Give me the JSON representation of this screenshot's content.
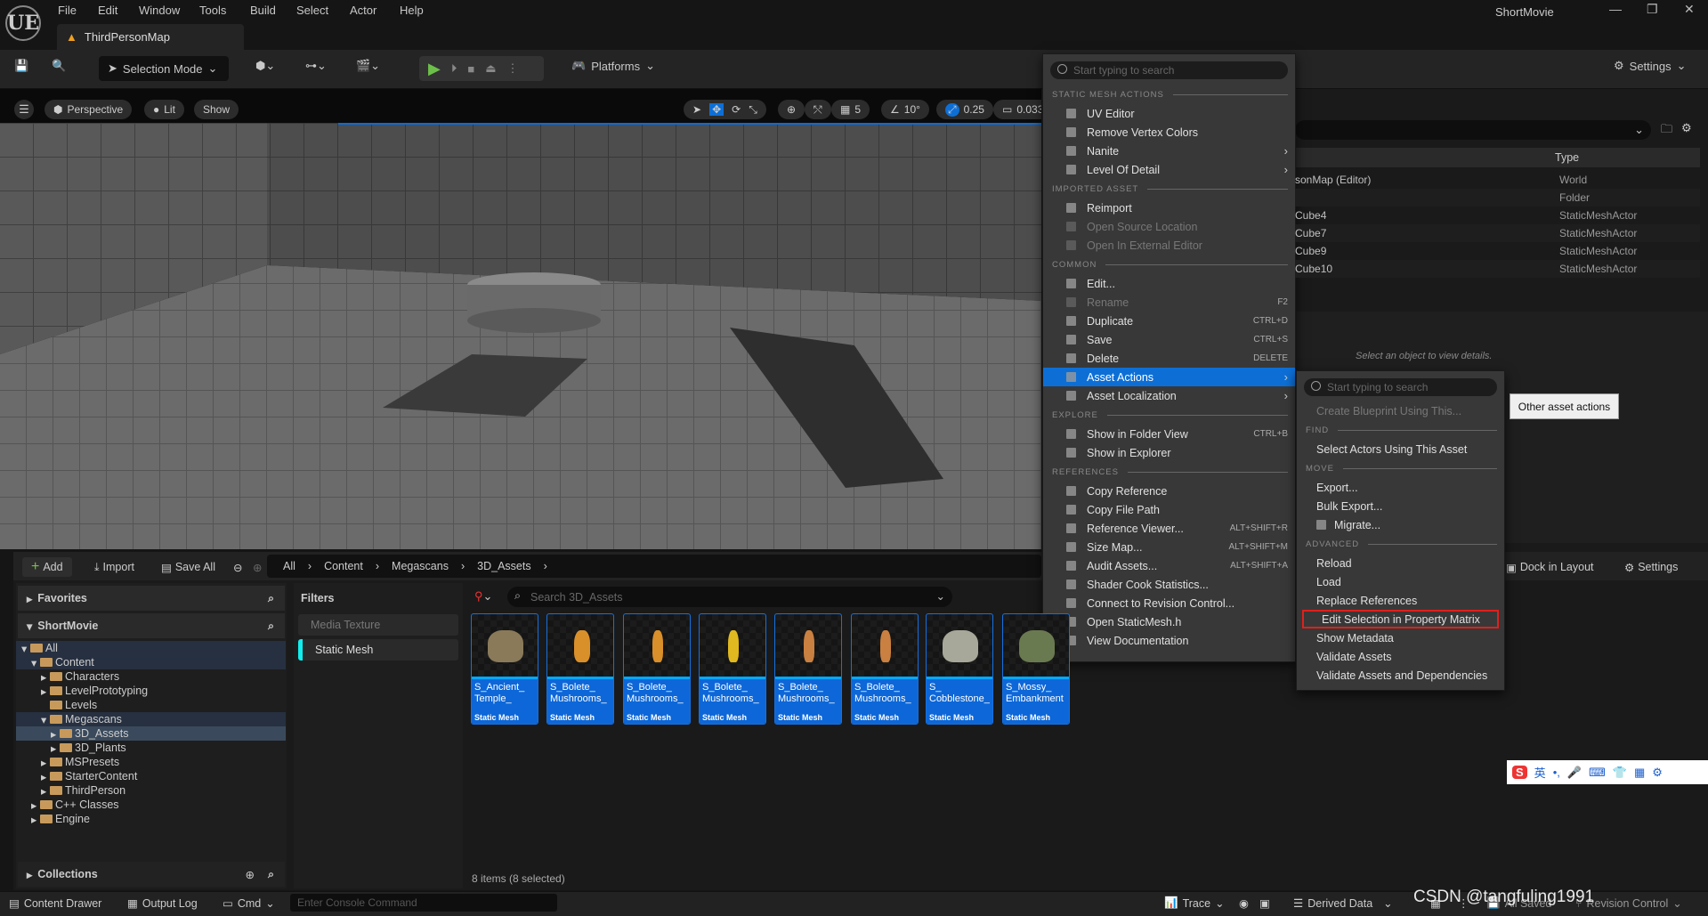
{
  "app": {
    "name": "ShortMovie",
    "logo": "UE",
    "level_tab": "ThirdPersonMap"
  },
  "menubar": [
    "File",
    "Edit",
    "Window",
    "Tools",
    "Build",
    "Select",
    "Actor",
    "Help"
  ],
  "toolbar": {
    "selection_mode": "Selection Mode",
    "platforms": "Platforms",
    "settings": "Settings"
  },
  "viewport": {
    "perspective": "Perspective",
    "lit": "Lit",
    "show": "Show",
    "grid_size": "5",
    "rotation_snap": "10°",
    "scale_snap": "0.25",
    "camera_speed": "0.033"
  },
  "outliner": {
    "type_header": "Type",
    "rows": [
      {
        "label": "sonMap (Editor)",
        "type": "World"
      },
      {
        "label": "",
        "type": "Folder"
      },
      {
        "label": "Cube4",
        "type": "StaticMeshActor"
      },
      {
        "label": "Cube7",
        "type": "StaticMeshActor"
      },
      {
        "label": "Cube9",
        "type": "StaticMeshActor"
      },
      {
        "label": "Cube10",
        "type": "StaticMeshActor"
      }
    ]
  },
  "details": {
    "empty_text": "Select an object to view details."
  },
  "content_browser": {
    "add": "Add",
    "import": "Import",
    "save_all": "Save All",
    "breadcrumbs": [
      "All",
      "Content",
      "Megascans",
      "3D_Assets"
    ],
    "dock_in_layout": "Dock in Layout",
    "settings": "Settings",
    "favorites": "Favorites",
    "project": "ShortMovie",
    "collections": "Collections",
    "tree": [
      {
        "label": "All",
        "depth": 0
      },
      {
        "label": "Content",
        "depth": 1
      },
      {
        "label": "Characters",
        "depth": 2
      },
      {
        "label": "LevelPrototyping",
        "depth": 2
      },
      {
        "label": "Levels",
        "depth": 2
      },
      {
        "label": "Megascans",
        "depth": 2
      },
      {
        "label": "3D_Assets",
        "depth": 3,
        "selected": true
      },
      {
        "label": "3D_Plants",
        "depth": 3
      },
      {
        "label": "MSPresets",
        "depth": 2
      },
      {
        "label": "StarterContent",
        "depth": 2
      },
      {
        "label": "ThirdPerson",
        "depth": 2
      },
      {
        "label": "C++ Classes",
        "depth": 1
      },
      {
        "label": "Engine",
        "depth": 1
      }
    ],
    "filters_title": "Filters",
    "filters": [
      "Media Texture",
      "Static Mesh"
    ],
    "search_placeholder": "Search 3D_Assets",
    "assets": [
      {
        "name": "S_Ancient_ Temple_",
        "type": "Static Mesh",
        "color": "#8a7a5a"
      },
      {
        "name": "S_Bolete_ Mushrooms_",
        "type": "Static Mesh",
        "color": "#d9902a"
      },
      {
        "name": "S_Bolete_ Mushrooms_",
        "type": "Static Mesh",
        "color": "#d98f2a"
      },
      {
        "name": "S_Bolete_ Mushrooms_",
        "type": "Static Mesh",
        "color": "#e0b820"
      },
      {
        "name": "S_Bolete_ Mushrooms_",
        "type": "Static Mesh",
        "color": "#c98040"
      },
      {
        "name": "S_Bolete_ Mushrooms_",
        "type": "Static Mesh",
        "color": "#c98040"
      },
      {
        "name": "S_ Cobblestone_",
        "type": "Static Mesh",
        "color": "#a8a89a"
      },
      {
        "name": "S_Mossy_ Embankment",
        "type": "Static Mesh",
        "color": "#6a7a50"
      }
    ],
    "item_count": "8 items (8 selected)"
  },
  "context_menu": {
    "search_placeholder": "Start typing to search",
    "sections": [
      {
        "header": "STATIC MESH ACTIONS",
        "items": [
          {
            "label": "UV Editor",
            "icon": "uv-grid-icon"
          },
          {
            "label": "Remove Vertex Colors",
            "icon": "droplet-icon"
          },
          {
            "label": "Nanite",
            "icon": "wrench-icon",
            "submenu": true
          },
          {
            "label": "Level Of Detail",
            "icon": "lod-icon",
            "submenu": true
          }
        ]
      },
      {
        "header": "IMPORTED ASSET",
        "items": [
          {
            "label": "Reimport",
            "icon": "reimport-icon"
          },
          {
            "label": "Open Source Location",
            "icon": "open-location-icon",
            "disabled": true
          },
          {
            "label": "Open In External Editor",
            "icon": "external-editor-icon",
            "disabled": true
          }
        ]
      },
      {
        "header": "COMMON",
        "items": [
          {
            "label": "Edit...",
            "icon": "pencil-icon"
          },
          {
            "label": "Rename",
            "icon": "rename-icon",
            "shortcut": "F2",
            "disabled": true
          },
          {
            "label": "Duplicate",
            "icon": "duplicate-icon",
            "shortcut": "CTRL+D"
          },
          {
            "label": "Save",
            "icon": "save-icon",
            "shortcut": "CTRL+S"
          },
          {
            "label": "Delete",
            "icon": "trash-icon",
            "shortcut": "DELETE"
          },
          {
            "label": "Asset Actions",
            "icon": "wrench-icon",
            "submenu": true,
            "highlighted": true
          },
          {
            "label": "Asset Localization",
            "icon": "flag-icon",
            "submenu": true
          }
        ]
      },
      {
        "header": "EXPLORE",
        "items": [
          {
            "label": "Show in Folder View",
            "icon": "folder-view-icon",
            "shortcut": "CTRL+B"
          },
          {
            "label": "Show in Explorer",
            "icon": "explorer-icon"
          }
        ]
      },
      {
        "header": "REFERENCES",
        "items": [
          {
            "label": "Copy Reference",
            "icon": "copy-icon"
          },
          {
            "label": "Copy File Path",
            "icon": "copy-icon"
          },
          {
            "label": "Reference Viewer...",
            "icon": "reference-viewer-icon",
            "shortcut": "ALT+SHIFT+R"
          },
          {
            "label": "Size Map...",
            "icon": "size-map-icon",
            "shortcut": "ALT+SHIFT+M"
          },
          {
            "label": "Audit Assets...",
            "icon": "audit-icon",
            "shortcut": "ALT+SHIFT+A"
          },
          {
            "label": "Shader Cook Statistics...",
            "icon": "statistics-icon"
          },
          {
            "label": "Connect to Revision Control...",
            "icon": "revision-control-icon"
          },
          {
            "label": "Open StaticMesh.h",
            "icon": "source-file-icon"
          },
          {
            "label": "View Documentation",
            "icon": "documentation-icon"
          }
        ]
      }
    ]
  },
  "submenu": {
    "search_placeholder": "Start typing to search",
    "sections": [
      {
        "header": "",
        "items": [
          {
            "label": "Create Blueprint Using This...",
            "disabled": true
          }
        ]
      },
      {
        "header": "FIND",
        "items": [
          {
            "label": "Select Actors Using This Asset"
          }
        ]
      },
      {
        "header": "MOVE",
        "items": [
          {
            "label": "Export..."
          },
          {
            "label": "Bulk Export..."
          },
          {
            "label": "Migrate...",
            "icon": "migrate-icon"
          }
        ]
      },
      {
        "header": "ADVANCED",
        "items": [
          {
            "label": "Reload"
          },
          {
            "label": "Load"
          },
          {
            "label": "Replace References"
          },
          {
            "label": "Edit Selection in Property Matrix",
            "boxed": true
          },
          {
            "label": "Show Metadata"
          },
          {
            "label": "Validate Assets"
          },
          {
            "label": "Validate Assets and Dependencies"
          }
        ]
      }
    ]
  },
  "tooltip": "Other asset actions",
  "statusbar": {
    "content_drawer": "Content Drawer",
    "output_log": "Output Log",
    "cmd": "Cmd",
    "console_placeholder": "Enter Console Command",
    "trace": "Trace",
    "derived_data": "Derived Data",
    "all_saved": "All Saved",
    "revision_control": "Revision Control"
  },
  "ime": {
    "lang": "英"
  },
  "watermark": "CSDN @tangfuling1991",
  "colors": {
    "accent": "#0d6fd6",
    "highlight_box": "#e0201c",
    "asset_label": "#0d67d8"
  }
}
